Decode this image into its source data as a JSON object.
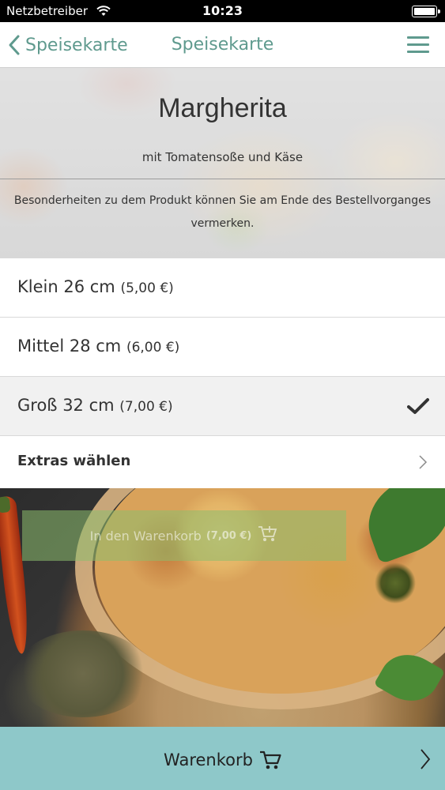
{
  "status_bar": {
    "carrier": "Netzbetreiber",
    "time": "10:23",
    "wifi_icon": "wifi-icon",
    "battery_icon": "battery-icon"
  },
  "nav": {
    "back_label": "Speisekarte",
    "title": "Speisekarte",
    "menu_icon": "hamburger-menu-icon",
    "accent_color": "#5f9a8e"
  },
  "product": {
    "name": "Margherita",
    "description": "mit Tomatensoße und Käse",
    "note": "Besonderheiten zu dem Produkt können Sie am Ende des Bestellvorganges vermerken."
  },
  "sizes": [
    {
      "label": "Klein 26 cm",
      "price": "(5,00 €)",
      "selected": false
    },
    {
      "label": "Mittel 28 cm",
      "price": "(6,00 €)",
      "selected": false
    },
    {
      "label": "Groß 32 cm",
      "price": "(7,00 €)",
      "selected": true
    }
  ],
  "extras": {
    "label": "Extras wählen"
  },
  "add_to_cart": {
    "label": "In den Warenkorb",
    "price": "(7,00 €)"
  },
  "cart_bar": {
    "label": "Warenkorb",
    "background_color": "#8ec8c9"
  }
}
